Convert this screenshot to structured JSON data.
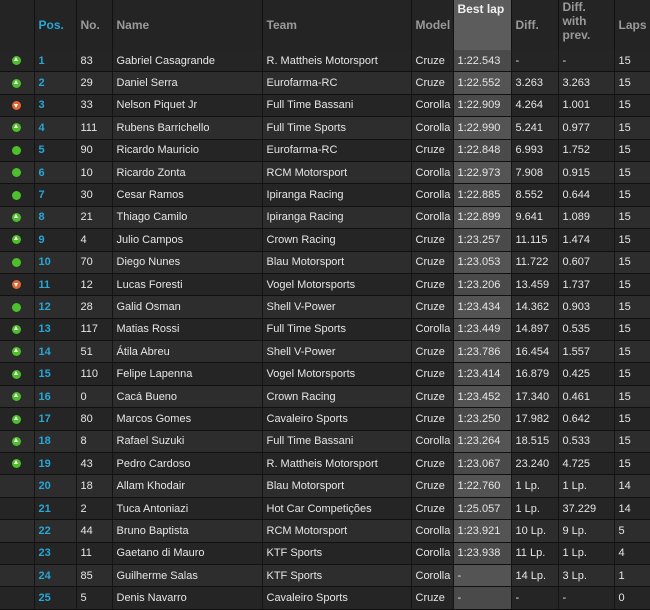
{
  "headers": {
    "pos": "Pos.",
    "no": "No.",
    "name": "Name",
    "team": "Team",
    "model": "Model",
    "best_lap": "Best lap",
    "diff": "Diff.",
    "diff_prev": "Diff. with prev.",
    "laps": "Laps"
  },
  "colors": {
    "accent": "#27a7d6",
    "up": "#4cbf2a",
    "down": "#e06633"
  },
  "rows": [
    {
      "pos": "1",
      "no": "83",
      "name": "Gabriel Casagrande",
      "team": "R. Mattheis Motorsport",
      "model": "Cruze",
      "best": "1:22.543",
      "diff": "-",
      "diffp": "-",
      "laps": "15",
      "icon": "up-arrow-icon"
    },
    {
      "pos": "2",
      "no": "29",
      "name": "Daniel Serra",
      "team": "Eurofarma-RC",
      "model": "Cruze",
      "best": "1:22.552",
      "diff": "3.263",
      "diffp": "3.263",
      "laps": "15",
      "icon": "up-arrow-icon"
    },
    {
      "pos": "3",
      "no": "33",
      "name": "Nelson Piquet Jr",
      "team": "Full Time Bassani",
      "model": "Corolla",
      "best": "1:22.909",
      "diff": "4.264",
      "diffp": "1.001",
      "laps": "15",
      "icon": "down-arrow-icon"
    },
    {
      "pos": "4",
      "no": "111",
      "name": "Rubens Barrichello",
      "team": "Full Time Sports",
      "model": "Corolla",
      "best": "1:22.990",
      "diff": "5.241",
      "diffp": "0.977",
      "laps": "15",
      "icon": "up-arrow-icon"
    },
    {
      "pos": "5",
      "no": "90",
      "name": "Ricardo Mauricio",
      "team": "Eurofarma-RC",
      "model": "Cruze",
      "best": "1:22.848",
      "diff": "6.993",
      "diffp": "1.752",
      "laps": "15",
      "icon": "no-change-icon"
    },
    {
      "pos": "6",
      "no": "10",
      "name": "Ricardo Zonta",
      "team": "RCM Motorsport",
      "model": "Corolla",
      "best": "1:22.973",
      "diff": "7.908",
      "diffp": "0.915",
      "laps": "15",
      "icon": "no-change-icon"
    },
    {
      "pos": "7",
      "no": "30",
      "name": "Cesar Ramos",
      "team": "Ipiranga Racing",
      "model": "Corolla",
      "best": "1:22.885",
      "diff": "8.552",
      "diffp": "0.644",
      "laps": "15",
      "icon": "no-change-icon"
    },
    {
      "pos": "8",
      "no": "21",
      "name": "Thiago Camilo",
      "team": "Ipiranga Racing",
      "model": "Corolla",
      "best": "1:22.899",
      "diff": "9.641",
      "diffp": "1.089",
      "laps": "15",
      "icon": "up-arrow-icon"
    },
    {
      "pos": "9",
      "no": "4",
      "name": "Julio Campos",
      "team": "Crown Racing",
      "model": "Cruze",
      "best": "1:23.257",
      "diff": "11.115",
      "diffp": "1.474",
      "laps": "15",
      "icon": "up-arrow-icon"
    },
    {
      "pos": "10",
      "no": "70",
      "name": "Diego Nunes",
      "team": "Blau Motorsport",
      "model": "Cruze",
      "best": "1:23.053",
      "diff": "11.722",
      "diffp": "0.607",
      "laps": "15",
      "icon": "no-change-icon"
    },
    {
      "pos": "11",
      "no": "12",
      "name": "Lucas Foresti",
      "team": "Vogel Motorsports",
      "model": "Cruze",
      "best": "1:23.206",
      "diff": "13.459",
      "diffp": "1.737",
      "laps": "15",
      "icon": "down-arrow-icon"
    },
    {
      "pos": "12",
      "no": "28",
      "name": "Galid Osman",
      "team": "Shell V-Power",
      "model": "Cruze",
      "best": "1:23.434",
      "diff": "14.362",
      "diffp": "0.903",
      "laps": "15",
      "icon": "no-change-icon"
    },
    {
      "pos": "13",
      "no": "117",
      "name": "Matias Rossi",
      "team": "Full Time Sports",
      "model": "Corolla",
      "best": "1:23.449",
      "diff": "14.897",
      "diffp": "0.535",
      "laps": "15",
      "icon": "up-arrow-icon"
    },
    {
      "pos": "14",
      "no": "51",
      "name": "Átila Abreu",
      "team": "Shell V-Power",
      "model": "Cruze",
      "best": "1:23.786",
      "diff": "16.454",
      "diffp": "1.557",
      "laps": "15",
      "icon": "up-arrow-icon"
    },
    {
      "pos": "15",
      "no": "110",
      "name": "Felipe Lapenna",
      "team": "Vogel Motorsports",
      "model": "Cruze",
      "best": "1:23.414",
      "diff": "16.879",
      "diffp": "0.425",
      "laps": "15",
      "icon": "up-arrow-icon"
    },
    {
      "pos": "16",
      "no": "0",
      "name": "Cacá Bueno",
      "team": "Crown Racing",
      "model": "Cruze",
      "best": "1:23.452",
      "diff": "17.340",
      "diffp": "0.461",
      "laps": "15",
      "icon": "up-arrow-icon"
    },
    {
      "pos": "17",
      "no": "80",
      "name": "Marcos Gomes",
      "team": "Cavaleiro Sports",
      "model": "Cruze",
      "best": "1:23.250",
      "diff": "17.982",
      "diffp": "0.642",
      "laps": "15",
      "icon": "up-arrow-icon"
    },
    {
      "pos": "18",
      "no": "8",
      "name": "Rafael Suzuki",
      "team": "Full Time Bassani",
      "model": "Corolla",
      "best": "1:23.264",
      "diff": "18.515",
      "diffp": "0.533",
      "laps": "15",
      "icon": "up-arrow-icon"
    },
    {
      "pos": "19",
      "no": "43",
      "name": "Pedro Cardoso",
      "team": "R. Mattheis Motorsport",
      "model": "Cruze",
      "best": "1:23.067",
      "diff": "23.240",
      "diffp": "4.725",
      "laps": "15",
      "icon": "up-arrow-icon"
    },
    {
      "pos": "20",
      "no": "18",
      "name": "Allam Khodair",
      "team": "Blau Motorsport",
      "model": "Cruze",
      "best": "1:22.760",
      "diff": "1 Lp.",
      "diffp": "1 Lp.",
      "laps": "14",
      "icon": ""
    },
    {
      "pos": "21",
      "no": "2",
      "name": "Tuca Antoniazi",
      "team": "Hot Car Competições",
      "model": "Cruze",
      "best": "1:25.057",
      "diff": "1 Lp.",
      "diffp": "37.229",
      "laps": "14",
      "icon": ""
    },
    {
      "pos": "22",
      "no": "44",
      "name": "Bruno Baptista",
      "team": "RCM Motorsport",
      "model": "Corolla",
      "best": "1:23.921",
      "diff": "10 Lp.",
      "diffp": "9 Lp.",
      "laps": "5",
      "icon": ""
    },
    {
      "pos": "23",
      "no": "11",
      "name": "Gaetano di Mauro",
      "team": "KTF Sports",
      "model": "Corolla",
      "best": "1:23.938",
      "diff": "11 Lp.",
      "diffp": "1 Lp.",
      "laps": "4",
      "icon": ""
    },
    {
      "pos": "24",
      "no": "85",
      "name": "Guilherme Salas",
      "team": "KTF Sports",
      "model": "Corolla",
      "best": "-",
      "diff": "14 Lp.",
      "diffp": "3 Lp.",
      "laps": "1",
      "icon": ""
    },
    {
      "pos": "25",
      "no": "5",
      "name": "Denis Navarro",
      "team": "Cavaleiro Sports",
      "model": "Cruze",
      "best": "-",
      "diff": "-",
      "diffp": "-",
      "laps": "0",
      "icon": ""
    }
  ]
}
